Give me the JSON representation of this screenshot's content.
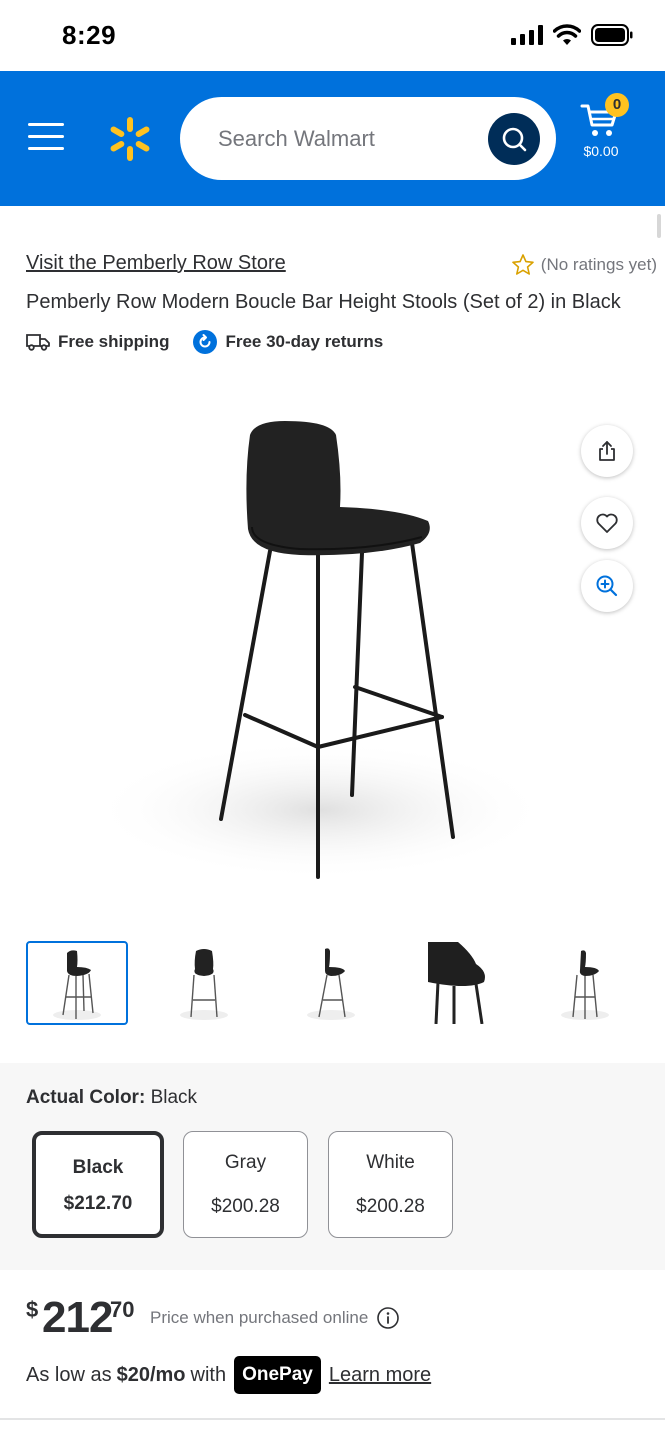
{
  "status_bar": {
    "time": "8:29"
  },
  "header": {
    "search_placeholder": "Search Walmart",
    "cart_count": "0",
    "cart_total": "$0.00",
    "brand_color": "#0071dc",
    "spark_color": "#ffc220"
  },
  "product": {
    "store_link": "Visit the Pemberly Row Store",
    "ratings_text": "(No ratings yet)",
    "title": "Pemberly Row Modern Boucle Bar Height Stools (Set of 2) in Black",
    "badges": {
      "shipping": "Free shipping",
      "returns": "Free 30-day returns"
    }
  },
  "image_actions": [
    "share-icon",
    "heart-icon",
    "zoom-in-icon"
  ],
  "thumbnails": [
    {
      "name": "thumbnail-1",
      "active": true
    },
    {
      "name": "thumbnail-2",
      "active": false
    },
    {
      "name": "thumbnail-3",
      "active": false
    },
    {
      "name": "thumbnail-4",
      "active": false
    },
    {
      "name": "thumbnail-5",
      "active": false
    }
  ],
  "variants": {
    "label": "Actual Color:",
    "selected_value": "Black",
    "options": [
      {
        "name": "Black",
        "price": "$212.70",
        "selected": true
      },
      {
        "name": "Gray",
        "price": "$200.28",
        "selected": false
      },
      {
        "name": "White",
        "price": "$200.28",
        "selected": false
      }
    ]
  },
  "price": {
    "currency": "$",
    "dollars": "212",
    "cents": "70",
    "note": "Price when purchased online"
  },
  "affordability": {
    "prefix": "As low as",
    "amount": "$20/mo",
    "with": "with",
    "provider": "OnePay",
    "link": "Learn more"
  }
}
